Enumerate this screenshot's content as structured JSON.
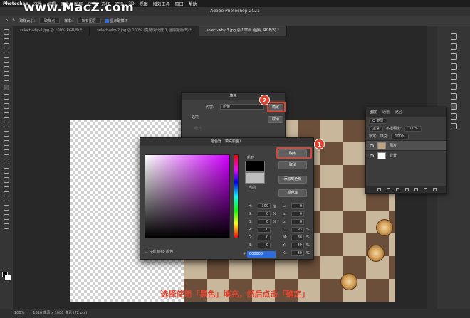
{
  "menubar": {
    "app": "Photoshop",
    "items": [
      "文件",
      "编辑",
      "图像",
      "图层",
      "文字",
      "选择",
      "滤镜",
      "3D",
      "视图",
      "增效工具",
      "窗口",
      "帮助"
    ]
  },
  "watermark": "www.MacZ.com",
  "window_title": "Adobe Photoshop 2021",
  "options": {
    "sample_size_label": "取样大小:",
    "sample_size_value": "取样点",
    "sample_label": "样本:",
    "sample_value": "所有图层",
    "show_ring": "显示取样环"
  },
  "tabs": [
    {
      "label": "select-why-1.jpg @ 100%(RGB/8) *"
    },
    {
      "label": "select-why-2.jpg @ 100% (亮度/对比度 1, 图层蒙版/8) *"
    },
    {
      "label": "select-why-3.jpg @ 100% (图片, RGB/8) *"
    }
  ],
  "fill_dialog": {
    "title": "填充",
    "content_label": "内容:",
    "content_value": "颜色...",
    "options_label": "选项",
    "mode_label": "模式:",
    "ok": "确定",
    "cancel": "取消"
  },
  "picker": {
    "title": "拾色器（填充颜色）",
    "new_label": "新的",
    "current_label": "当前",
    "ok": "确定",
    "cancel": "取消",
    "add_swatch": "添加到色板",
    "library": "颜色库",
    "web_only": "只有 Web 颜色",
    "h_label": "H:",
    "h_value": "300",
    "h_unit": "度",
    "s_label": "S:",
    "s_value": "0",
    "s_unit": "%",
    "b_label": "B:",
    "b_value": "0",
    "b_unit": "%",
    "r_label": "R:",
    "r_value": "0",
    "g_label": "G:",
    "g_value": "0",
    "bb_label": "B:",
    "bb_value": "0",
    "l_label": "L:",
    "l_value": "0",
    "a_label": "a:",
    "a_value": "0",
    "b2_label": "b:",
    "b2_value": "0",
    "c_label": "C:",
    "c_value": "93",
    "c_unit": "%",
    "m_label": "M:",
    "m_value": "88",
    "m_unit": "%",
    "y_label": "Y:",
    "y_value": "89",
    "y_unit": "%",
    "k_label": "K:",
    "k_value": "80",
    "k_unit": "%",
    "hex_label": "#",
    "hex_value": "000000"
  },
  "layers_panel": {
    "tabs": [
      "图层",
      "通道",
      "路径"
    ],
    "kind_label": "Q 类型",
    "blend_mode": "正常",
    "opacity_label": "不透明度:",
    "opacity_value": "100%",
    "lock_label": "锁定:",
    "fill_label": "填充:",
    "fill_value": "100%",
    "layers": [
      {
        "name": "图片"
      },
      {
        "name": "背景"
      }
    ]
  },
  "markers": {
    "one": "1",
    "two": "2"
  },
  "caption": "选择使用「黑色」填充，然后点击「确定」",
  "status": {
    "zoom": "100%",
    "doc": "1616 像素 x 1080 像素 (72 ppi)"
  },
  "colors": {
    "accent": "#e0432f",
    "selection": "#2d6cdf"
  }
}
